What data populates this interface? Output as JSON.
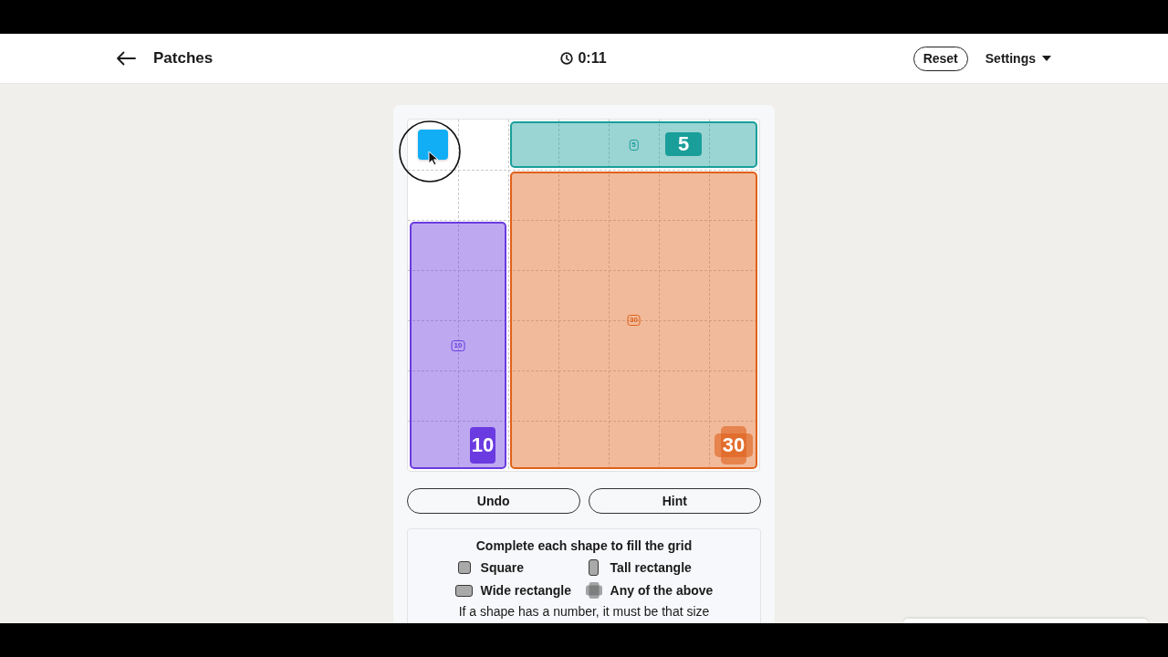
{
  "header": {
    "title": "Patches",
    "timer": "0:11",
    "buttons": [
      {
        "kind": "outlined",
        "label": "Reset"
      },
      {
        "kind": "menu",
        "label": "Settings"
      }
    ]
  },
  "puzzle": {
    "shapes": [
      {
        "kind": "draft",
        "color": "#12aef5"
      },
      {
        "kind": "wide",
        "clue": "5",
        "size_marker": "5",
        "color": "#1a9e9a"
      },
      {
        "kind": "tall",
        "clue": "10",
        "size_marker": "10",
        "color": "#6a3be0"
      },
      {
        "kind": "any",
        "clue": "30",
        "size_marker": "30",
        "color": "#e0611a"
      }
    ]
  },
  "actions": [
    "Undo",
    "Hint"
  ],
  "legend": {
    "heading": "Complete each shape to fill the grid",
    "items": [
      {
        "kind": "square",
        "label": "Square"
      },
      {
        "kind": "tall",
        "label": "Tall rectangle"
      },
      {
        "kind": "wide",
        "label": "Wide rectangle"
      },
      {
        "kind": "any",
        "label": "Any of the above"
      }
    ],
    "note": "If a shape has a number, it must be that size"
  }
}
